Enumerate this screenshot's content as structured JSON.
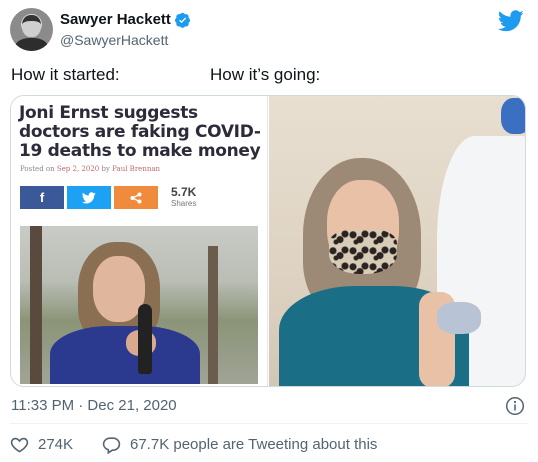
{
  "author": {
    "name": "Sawyer Hackett",
    "handle": "@SawyerHackett"
  },
  "tweet": {
    "text_left": "How it started:",
    "text_right": "How it’s going:"
  },
  "media_left": {
    "headline": "Joni Ernst suggests doctors are faking COVID-19 deaths to make money",
    "posted_prefix": "Posted on",
    "posted_date": "Sep 2, 2020",
    "posted_by": "by",
    "posted_author": "Paul Brennan",
    "share_buttons": [
      "f",
      "🐦",
      "<"
    ],
    "shares_count": "5.7K",
    "shares_label": "Shares"
  },
  "meta": {
    "timestamp": "11:33 PM · Dec 21, 2020"
  },
  "footer": {
    "like_count": "274K",
    "tweeting_text": "67.7K people are Tweeting about this"
  },
  "colors": {
    "twitter_blue": "#1d9bf0",
    "secondary_text": "#536471",
    "facebook": "#3b5998",
    "twitter_share": "#1da1f2",
    "share_orange": "#f08a3c"
  },
  "icons": [
    "verified-badge-icon",
    "twitter-logo-icon",
    "info-icon",
    "heart-icon",
    "reply-bubble-icon"
  ]
}
